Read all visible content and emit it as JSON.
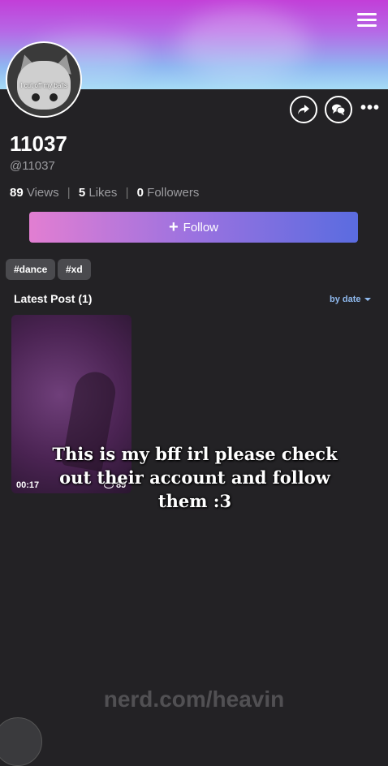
{
  "avatar": {
    "caption": "I cut off my balls"
  },
  "profile": {
    "name": "11037",
    "handle": "@11037"
  },
  "stats": {
    "views_count": "89",
    "views_label": "Views",
    "likes_count": "5",
    "likes_label": "Likes",
    "followers_count": "0",
    "followers_label": "Followers",
    "separator": "|"
  },
  "follow_button": {
    "label": "Follow",
    "icon": "+"
  },
  "tags": [
    "#dance",
    "#xd"
  ],
  "section": {
    "title": "Latest Post (1)",
    "sort_label": "by date"
  },
  "post": {
    "duration": "00:17",
    "views": "89"
  },
  "overlay_caption": "This is my bff irl please check out their account and follow them :3",
  "watermark": "nerd.com/heavin",
  "icons": {
    "menu": "hamburger-menu-icon",
    "share": "share-arrow-icon",
    "chat": "chat-bubbles-icon",
    "more": "more-dots-icon",
    "views": "eye-icon"
  },
  "colors": {
    "background": "#232225",
    "follow_gradient_start": "#e27ed2",
    "follow_gradient_end": "#5a6ce0",
    "sort_link": "#8fb9ee"
  }
}
